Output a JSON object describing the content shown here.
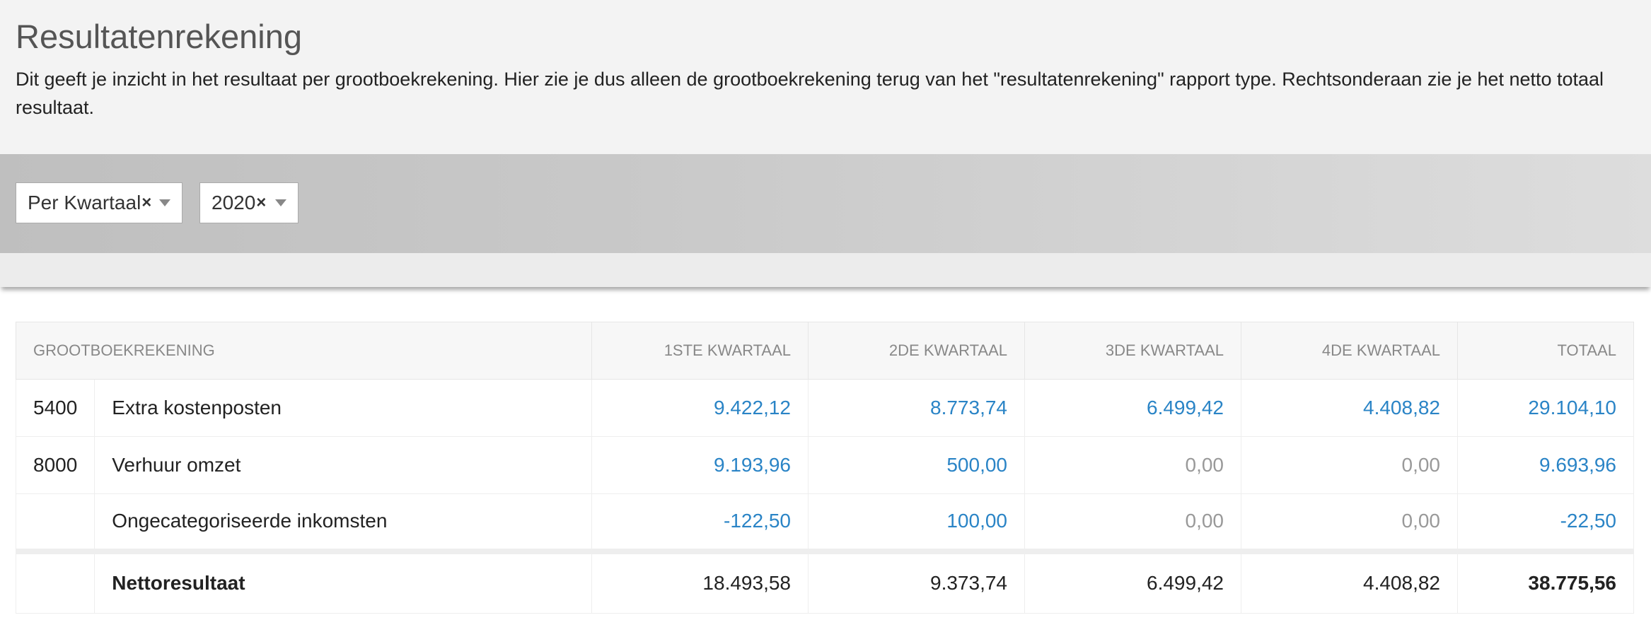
{
  "page": {
    "title": "Resultatenrekening",
    "description": "Dit geeft je inzicht in het resultaat per grootboekrekening. Hier zie je dus alleen de grootboekrekening terug van het \"resultatenrekening\" rapport type. Rechtsonderaan zie je het netto totaal resultaat."
  },
  "filters": {
    "period": {
      "value": "Per Kwartaal",
      "clear": "×"
    },
    "year": {
      "value": "2020",
      "clear": "×"
    }
  },
  "table": {
    "headers": [
      "GROOTBOEKREKENING",
      "1STE KWARTAAL",
      "2DE KWARTAAL",
      "3DE KWARTAAL",
      "4DE KWARTAAL",
      "TOTAAL"
    ],
    "rows": [
      {
        "code": "5400",
        "name": "Extra kostenposten",
        "values": [
          "9.422,12",
          "8.773,74",
          "6.499,42",
          "4.408,82",
          "29.104,10"
        ]
      },
      {
        "code": "8000",
        "name": "Verhuur omzet",
        "values": [
          "9.193,96",
          "500,00",
          "0,00",
          "0,00",
          "9.693,96"
        ]
      },
      {
        "code": "",
        "name": "Ongecategoriseerde inkomsten",
        "values": [
          "-122,50",
          "100,00",
          "0,00",
          "0,00",
          "-22,50"
        ]
      }
    ],
    "total": {
      "name": "Nettoresultaat",
      "values": [
        "18.493,58",
        "9.373,74",
        "6.499,42",
        "4.408,82",
        "38.775,56"
      ]
    }
  },
  "colors": {
    "link_value": "#2a84c6",
    "zero_value": "#999999"
  }
}
